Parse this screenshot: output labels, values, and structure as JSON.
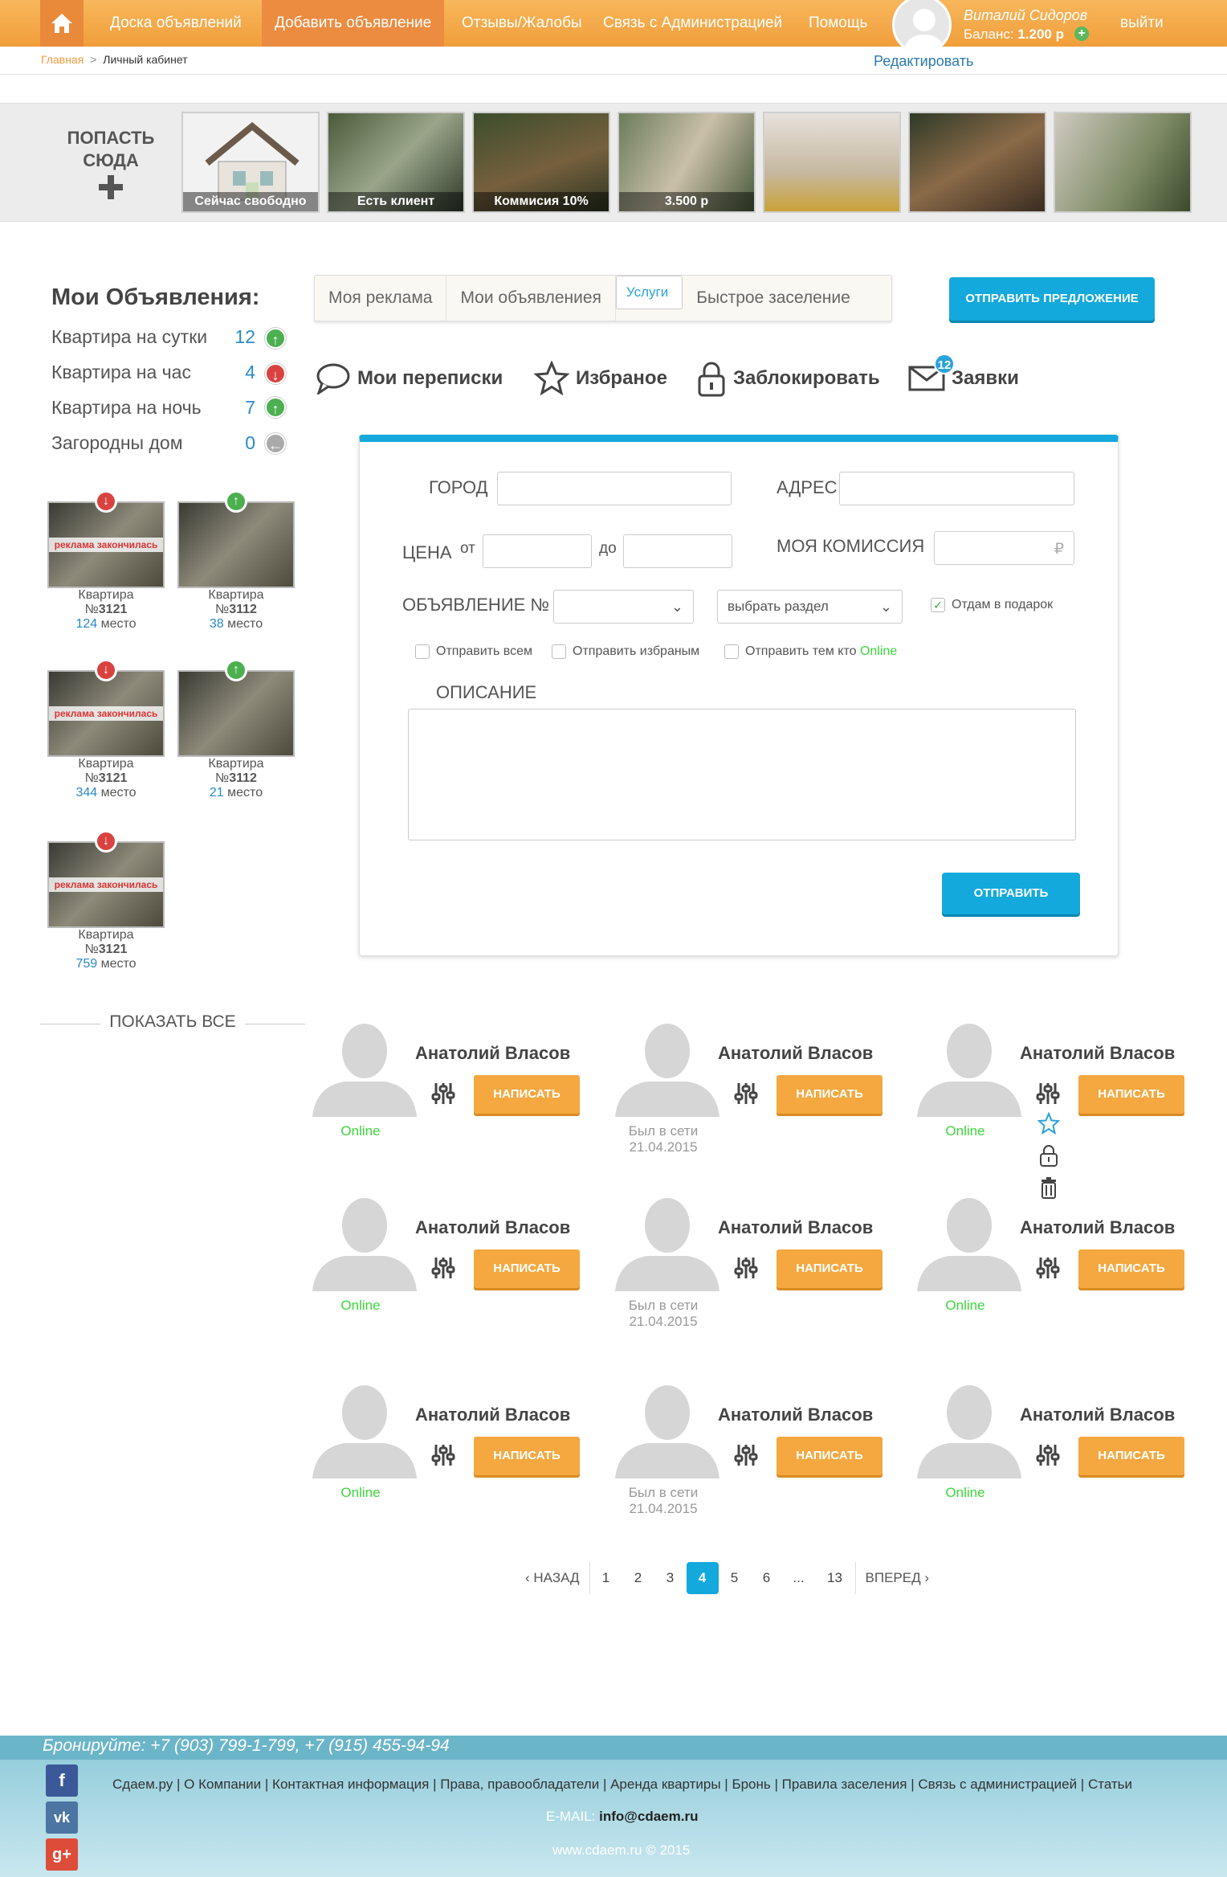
{
  "header": {
    "nav": [
      "Доска объявлений",
      "Добавить объявление",
      "Отзывы/Жалобы",
      "Связь с Администрацией",
      "Помощь"
    ],
    "user_name": "Виталий Сидоров",
    "balance_label": "Баланс:",
    "balance_value": "1.200 р",
    "logout": "выйти",
    "edit": "Редактировать"
  },
  "breadcrumb": {
    "home": "Главная",
    "sep": ">",
    "current": "Личный кабинет"
  },
  "strip": {
    "get_here": "ПОПАСТЬ СЮДА",
    "thumbs": [
      "Сейчас свободно",
      "Есть клиент",
      "Коммисия 10%",
      "3.500 р",
      "",
      "",
      ""
    ]
  },
  "left": {
    "title": "Мои Объявления:",
    "categories": [
      {
        "label": "Квартира на сутки",
        "count": "12",
        "trend": "up"
      },
      {
        "label": "Квартира на час",
        "count": "4",
        "trend": "down"
      },
      {
        "label": "Квартира на ночь",
        "count": "7",
        "trend": "up"
      },
      {
        "label": "Загородны дом",
        "count": "0",
        "trend": "back"
      }
    ],
    "cards": [
      {
        "type": "Квартира",
        "num_prefix": "№",
        "num": "3121",
        "place": "124",
        "place_label": "место",
        "ended": "реклама закончилась",
        "trend": "down"
      },
      {
        "type": "Квартира",
        "num_prefix": "№",
        "num": "3112",
        "place": "38",
        "place_label": "место",
        "ended": "",
        "trend": "up"
      },
      {
        "type": "Квартира",
        "num_prefix": "№",
        "num": "3121",
        "place": "344",
        "place_label": "место",
        "ended": "реклама закончилась",
        "trend": "down"
      },
      {
        "type": "Квартира",
        "num_prefix": "№",
        "num": "3112",
        "place": "21",
        "place_label": "место",
        "ended": "",
        "trend": "up"
      },
      {
        "type": "Квартира",
        "num_prefix": "№",
        "num": "3121",
        "place": "759",
        "place_label": "место",
        "ended": "реклама закончилась",
        "trend": "down"
      }
    ],
    "show_all": "ПОКАЗАТЬ ВСЕ"
  },
  "tabs": [
    "Моя реклама",
    "Мои объявлениея",
    "Услуги",
    "Быстрое заселение"
  ],
  "send_offer": "ОТПРАВИТЬ ПРЕДЛОЖЕНИЕ",
  "tools": {
    "chats": "Мои переписки",
    "favorites": "Избраное",
    "block": "Заблокировать",
    "requests": "Заявки",
    "requests_count": "12"
  },
  "form": {
    "city": "ГОРОД",
    "address": "АДРЕС",
    "price": "ЦЕНА",
    "from": "от",
    "to": "до",
    "commission": "МОЯ КОМИССИЯ",
    "currency": "₽",
    "ad_no": "ОБЪЯВЛЕНИЕ №",
    "section_placeholder": "выбрать раздел",
    "gift": "Отдам в подарок",
    "send_all": "Отправить всем",
    "send_fav": "Отправить избраным",
    "send_online_prefix": "Отправить тем кто",
    "online": "Online",
    "description": "ОПИСАНИЕ",
    "submit": "ОТПРАВИТЬ"
  },
  "users": [
    {
      "name": "Анатолий Власов",
      "status": "Online",
      "write": "НАПИСАТЬ"
    },
    {
      "name": "Анатолий Власов",
      "status": "Был в сети 21.04.2015",
      "write": "НАПИСАТЬ"
    },
    {
      "name": "Анатолий Власов",
      "status": "Online",
      "write": "НАПИСАТЬ"
    },
    {
      "name": "Анатолий Власов",
      "status": "Online",
      "write": "НАПИСАТЬ"
    },
    {
      "name": "Анатолий Власов",
      "status": "Был в сети 21.04.2015",
      "write": "НАПИСАТЬ"
    },
    {
      "name": "Анатолий Власов",
      "status": "Online",
      "write": "НАПИСАТЬ"
    },
    {
      "name": "Анатолий Власов",
      "status": "Online",
      "write": "НАПИСАТЬ"
    },
    {
      "name": "Анатолий Власов",
      "status": "Был в сети 21.04.2015",
      "write": "НАПИСАТЬ"
    },
    {
      "name": "Анатолий Власов",
      "status": "Online",
      "write": "НАПИСАТЬ"
    }
  ],
  "pager": {
    "prev": "НАЗАД",
    "next": "ВПЕРЕД",
    "pages": [
      "1",
      "2",
      "3",
      "4",
      "5",
      "6",
      "...",
      "13"
    ],
    "current": "4"
  },
  "footer": {
    "phones": "Бронируйте: +7 (903) 799-1-799, +7 (915) 455-94-94",
    "links": "Сдаем.ру | О Компании | Контактная информация | Права, правообладатели | Аренда квартиры | Бронь | Правила заселения | Связь с администрацией | Статьи",
    "email_label": "E-MAIL:",
    "email": "info@cdaem.ru",
    "site": "www.cdaem.ru",
    "copy": "© 2015"
  },
  "colors": {
    "orange": "#f19e3a",
    "blue": "#13a9dc",
    "online": "#3bd63b"
  }
}
